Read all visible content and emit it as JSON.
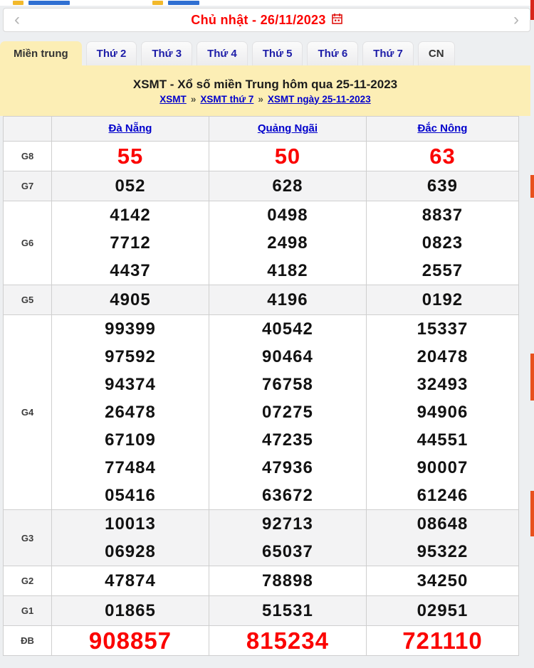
{
  "colors": {
    "accent_cream": "#fceeb5",
    "result_red": "#fb0300",
    "link_blue": "#0000cc",
    "tab_blue": "#1d1da8",
    "edge_orange": "#e8511d"
  },
  "date_nav": {
    "prev_icon": "‹",
    "next_icon": "›",
    "label": "Chủ nhật -  26/11/2023",
    "calendar_icon": "calendar"
  },
  "tabs": [
    {
      "label": "Miền trung",
      "active": true,
      "tone": "dark"
    },
    {
      "label": "Thứ 2",
      "active": false,
      "tone": "blue"
    },
    {
      "label": "Thứ 3",
      "active": false,
      "tone": "blue"
    },
    {
      "label": "Thứ 4",
      "active": false,
      "tone": "blue"
    },
    {
      "label": "Thứ 5",
      "active": false,
      "tone": "blue"
    },
    {
      "label": "Thứ 6",
      "active": false,
      "tone": "blue"
    },
    {
      "label": "Thứ 7",
      "active": false,
      "tone": "blue"
    },
    {
      "label": "CN",
      "active": false,
      "tone": "dark"
    }
  ],
  "title": {
    "heading": "XSMT - Xổ số miền Trung hôm qua 25-11-2023",
    "breadcrumb": {
      "links": [
        "XSMT",
        "XSMT thứ 7",
        "XSMT ngày 25-11-2023"
      ],
      "separator": "»"
    }
  },
  "table": {
    "columns": [
      "Đà Nẵng",
      "Quảng Ngãi",
      "Đắc Nông"
    ],
    "rows": [
      {
        "label": "G8",
        "style": "red-big",
        "shade": false,
        "values": [
          [
            "55"
          ],
          [
            "50"
          ],
          [
            "63"
          ]
        ]
      },
      {
        "label": "G7",
        "style": "black",
        "shade": true,
        "values": [
          [
            "052"
          ],
          [
            "628"
          ],
          [
            "639"
          ]
        ]
      },
      {
        "label": "G6",
        "style": "black",
        "shade": false,
        "values": [
          [
            "4142",
            "7712",
            "4437"
          ],
          [
            "0498",
            "2498",
            "4182"
          ],
          [
            "8837",
            "0823",
            "2557"
          ]
        ]
      },
      {
        "label": "G5",
        "style": "black",
        "shade": true,
        "values": [
          [
            "4905"
          ],
          [
            "4196"
          ],
          [
            "0192"
          ]
        ]
      },
      {
        "label": "G4",
        "style": "black",
        "shade": false,
        "values": [
          [
            "99399",
            "97592",
            "94374",
            "26478",
            "67109",
            "77484",
            "05416"
          ],
          [
            "40542",
            "90464",
            "76758",
            "07275",
            "47235",
            "47936",
            "63672"
          ],
          [
            "15337",
            "20478",
            "32493",
            "94906",
            "44551",
            "90007",
            "61246"
          ]
        ]
      },
      {
        "label": "G3",
        "style": "black",
        "shade": true,
        "values": [
          [
            "10013",
            "06928"
          ],
          [
            "92713",
            "65037"
          ],
          [
            "08648",
            "95322"
          ]
        ]
      },
      {
        "label": "G2",
        "style": "black",
        "shade": false,
        "values": [
          [
            "47874"
          ],
          [
            "78898"
          ],
          [
            "34250"
          ]
        ]
      },
      {
        "label": "G1",
        "style": "black",
        "shade": true,
        "values": [
          [
            "01865"
          ],
          [
            "51531"
          ],
          [
            "02951"
          ]
        ]
      },
      {
        "label": "ĐB",
        "style": "red-huge",
        "shade": false,
        "values": [
          [
            "908857"
          ],
          [
            "815234"
          ],
          [
            "721110"
          ]
        ]
      }
    ]
  }
}
